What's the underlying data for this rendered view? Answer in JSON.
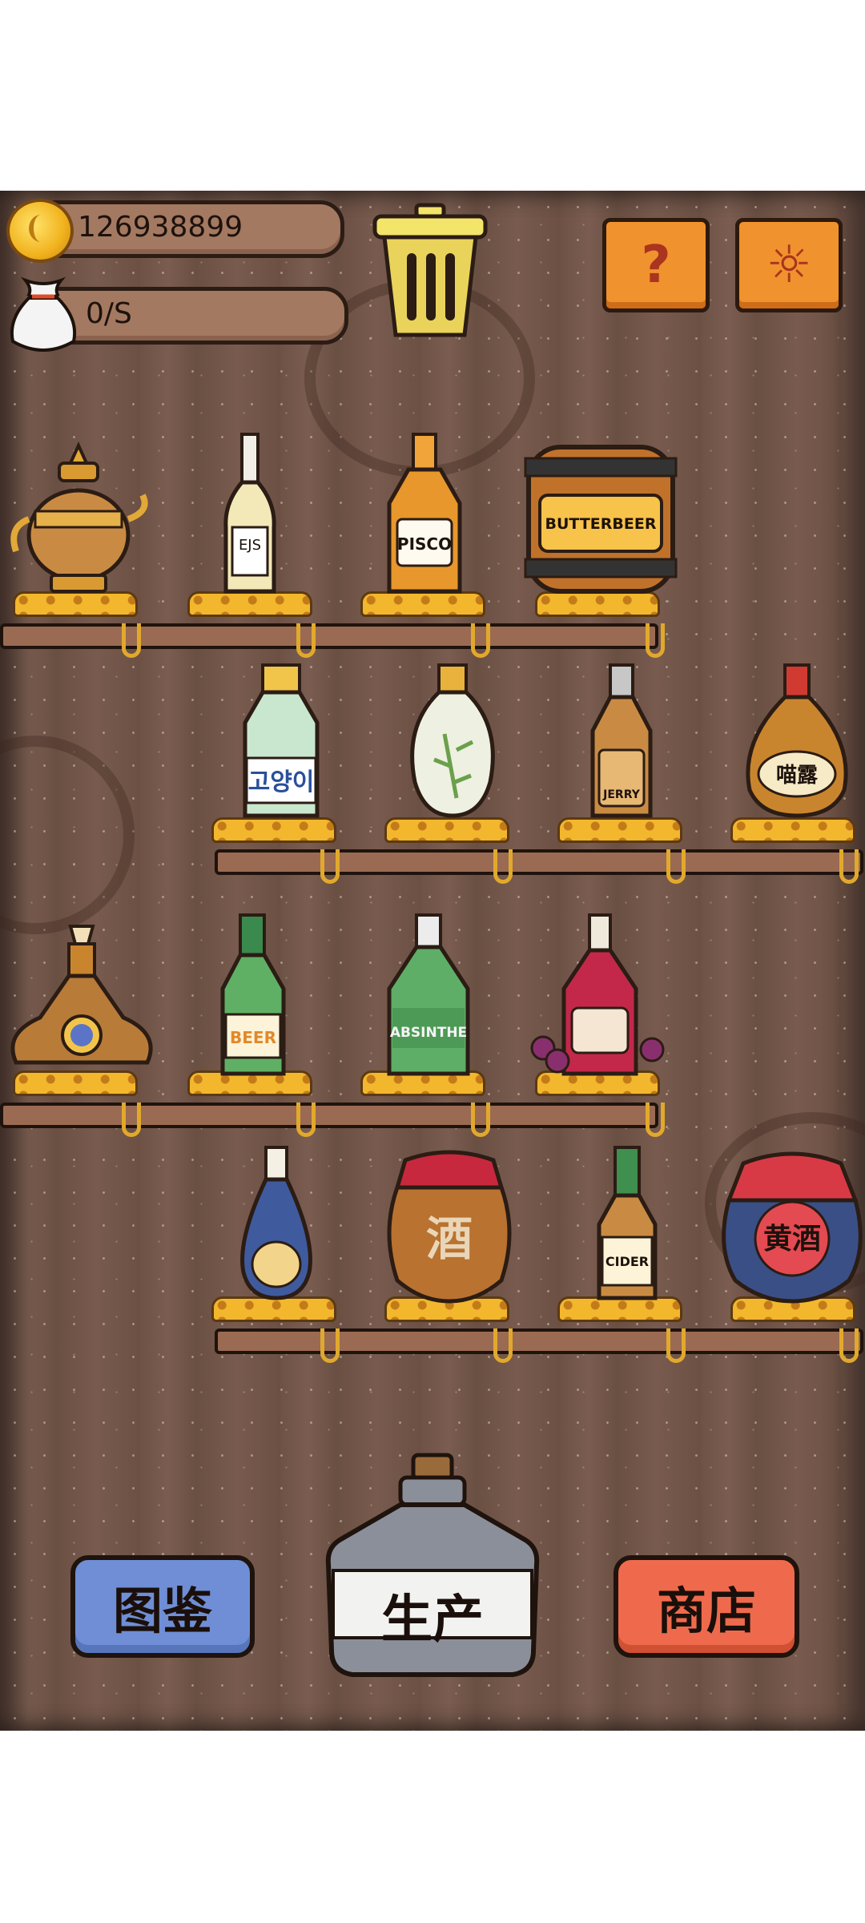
{
  "hud": {
    "coins": "126938899",
    "rate": "0/S"
  },
  "icons": {
    "coin": "gold-coin-icon",
    "bag": "money-bag-icon",
    "trash": "trash-can-icon",
    "help": "question-icon",
    "settings": "gear-icon"
  },
  "help_glyph": "?",
  "settings_glyph": "☼",
  "shelves": [
    {
      "items": [
        {
          "name": "teapot"
        },
        {
          "name": "clear-bottle",
          "label": "EJS"
        },
        {
          "name": "pisco-bottle",
          "label": "PISCO"
        },
        {
          "name": "butterbeer-barrel",
          "label": "BUTTERBEER"
        }
      ]
    },
    {
      "items": [
        {
          "name": "soju-bottle",
          "label": "고양이"
        },
        {
          "name": "bamboo-vase"
        },
        {
          "name": "whisky-bottle",
          "label": "JERRY"
        },
        {
          "name": "liqueur-bottle",
          "label": "喵露"
        }
      ]
    },
    {
      "items": [
        {
          "name": "ornate-decanter"
        },
        {
          "name": "beer-bottle",
          "label": "BEER"
        },
        {
          "name": "absinthe-bottle",
          "label": "ABSINTHE"
        },
        {
          "name": "wine-bottle"
        }
      ]
    },
    {
      "items": [
        {
          "name": "blue-bottle"
        },
        {
          "name": "jar-wine",
          "label": "酒"
        },
        {
          "name": "cider-bottle",
          "label": "CIDER"
        },
        {
          "name": "yellow-wine-jar",
          "label": "黄酒"
        }
      ]
    }
  ],
  "buttons": {
    "collection": "图鉴",
    "produce": "生产",
    "shop": "商店"
  },
  "colors": {
    "accent_orange": "#f0922d",
    "collection_blue": "#6f8ed5",
    "shop_red": "#ef6a4c"
  }
}
